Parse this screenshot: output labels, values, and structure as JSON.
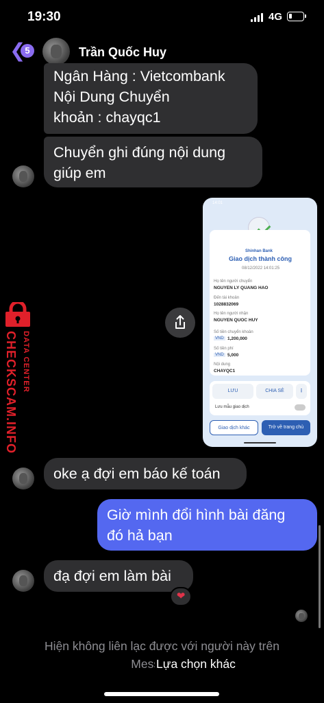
{
  "status": {
    "time": "19:30",
    "network": "4G"
  },
  "header": {
    "back_count": "5",
    "contact_name": "Trần Quốc Huy"
  },
  "messages": {
    "m1_line1": "Ngân Hàng : Vietcombank",
    "m1_line2": "Nội Dung Chuyển",
    "m1_line3": "khoản : chayqc1",
    "m2_line1": "Chuyển ghi đúng nội dung",
    "m2_line2": "giúp em",
    "m3": "oke ạ đợi em báo kế toán",
    "m4_line1": "Giờ mình đổi hình bài đăng",
    "m4_line2": "đó hả bạn",
    "m5": "đạ đợi em làm bài",
    "reaction": "❤"
  },
  "receipt": {
    "status_time": "14:01",
    "bank": "Shinhan Bank",
    "title": "Giao dịch thành công",
    "datetime": "08/12/2022 14:01:25",
    "sender_label": "Họ tên người chuyển",
    "sender": "NGUYEN LY QUANG HAO",
    "account_label": "Đến tài khoản",
    "account": "1028832069",
    "receiver_label": "Họ tên người nhận",
    "receiver": "NGUYEN QUOC HUY",
    "amount_label": "Số tiền chuyển khoản",
    "currency": "VND",
    "amount": "1,200,000",
    "fee_label": "Số tiền phí",
    "fee": "5,000",
    "content_label": "Nội dung",
    "content": "CHAYQC1",
    "save_btn": "LƯU",
    "share_btn": "CHIA SẺ",
    "template_label": "Lưu mẫu giao dịch",
    "other_btn": "Giao dịch khác",
    "home_btn": "Trở về trang chủ"
  },
  "watermark": {
    "line1": "DATA CENTER",
    "line2": "CHECKSCAM.INFO"
  },
  "footer": {
    "notice": "Hiện không liên lạc được với người này trên Messenger.",
    "link": "Lựa chọn khác"
  }
}
